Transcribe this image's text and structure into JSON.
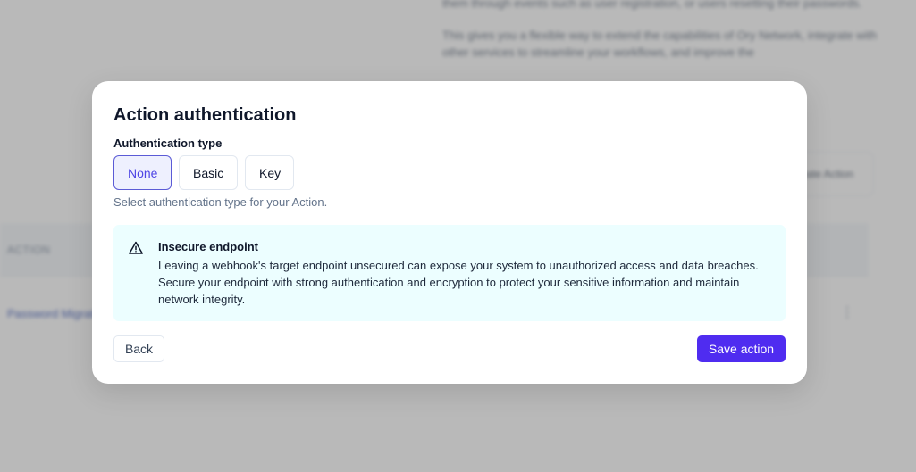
{
  "background": {
    "description_lines": [
      "them through events such as user registration, or users resetting their passwords.",
      "This gives you a flexible way to extend the capabilities of Ory Network, integrate with other services to streamline your workflows, and improve the"
    ],
    "create_button_label": "Create Action",
    "table_header": "ACTION",
    "table_row_label": "Password Migration",
    "row_menu_glyph": "⋮"
  },
  "modal": {
    "title": "Action authentication",
    "field_label": "Authentication type",
    "options": [
      {
        "label": "None",
        "selected": true
      },
      {
        "label": "Basic",
        "selected": false
      },
      {
        "label": "Key",
        "selected": false
      }
    ],
    "help_text": "Select authentication type for your Action.",
    "alert": {
      "icon": "warning-triangle-icon",
      "title": "Insecure endpoint",
      "body": "Leaving a webhook's target endpoint unsecured can expose your system to unauthorized access and data breaches. Secure your endpoint with strong authentication and encryption to protect your sensitive information and maintain network integrity.",
      "background_color": "#ecfeff"
    },
    "back_label": "Back",
    "save_label": "Save action",
    "accent_color": "#4f2cf0"
  }
}
